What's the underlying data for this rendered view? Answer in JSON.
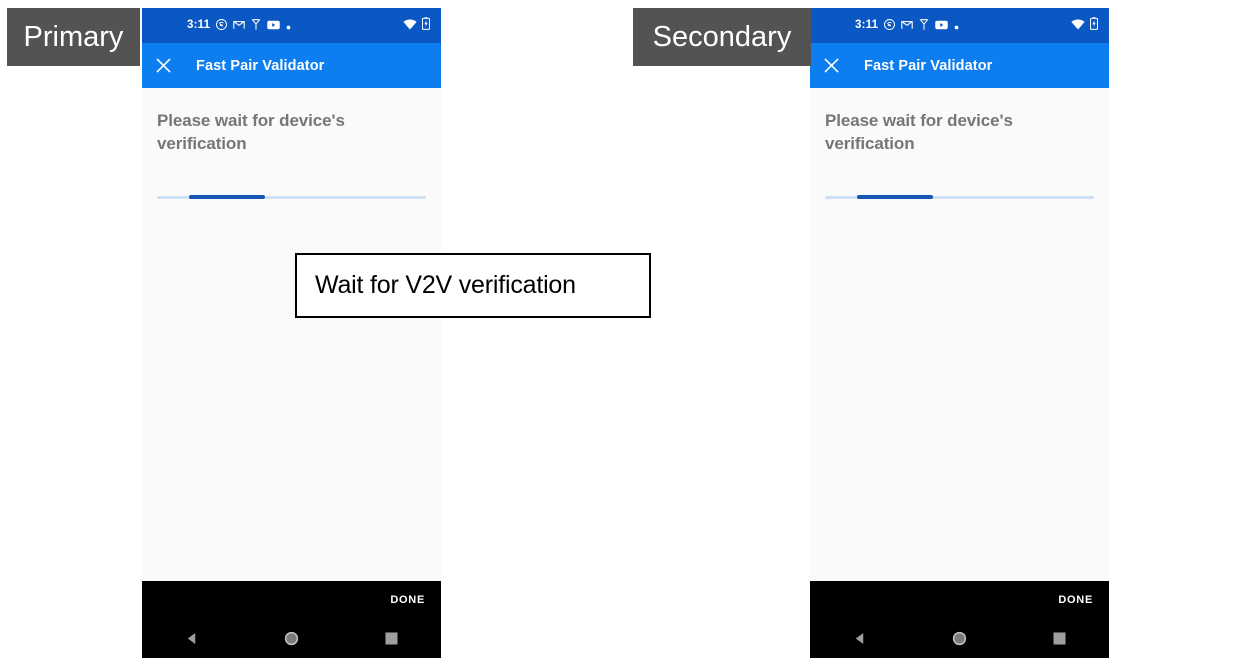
{
  "badges": {
    "primary": "Primary",
    "secondary": "Secondary"
  },
  "caption": {
    "text": "Wait for V2V verification"
  },
  "colors": {
    "status_bar": "#0b57c4",
    "app_bar": "#0d7ef0",
    "badge_bg": "#535353",
    "progress_fill": "#1457b5",
    "progress_track": "#cfe0f5",
    "body_text": "#767676",
    "nav_bar": "#000000",
    "screen_bg": "#fafafa"
  },
  "phones": [
    {
      "role": "primary",
      "status_bar": {
        "clock": "3:11",
        "icons": [
          "skype-icon",
          "gmail-icon",
          "hangouts-icon",
          "youtube-icon",
          "more-notifications-dot-icon"
        ],
        "right_icons": [
          "wifi-icon",
          "battery-icon"
        ]
      },
      "app_bar": {
        "close_icon": "close-icon",
        "title": "Fast Pair Validator"
      },
      "content": {
        "message": "Please wait for device's verification",
        "progress": {
          "indeterminate": true,
          "segment_start_pct": 12,
          "segment_end_pct": 40
        }
      },
      "bottom": {
        "done_label": "DONE",
        "nav_buttons": [
          "back-icon",
          "home-icon",
          "recents-icon"
        ]
      }
    },
    {
      "role": "secondary",
      "status_bar": {
        "clock": "3:11",
        "icons": [
          "skype-icon",
          "gmail-icon",
          "hangouts-icon",
          "youtube-icon",
          "more-notifications-dot-icon"
        ],
        "right_icons": [
          "wifi-icon",
          "battery-icon"
        ]
      },
      "app_bar": {
        "close_icon": "close-icon",
        "title": "Fast Pair Validator"
      },
      "content": {
        "message": "Please wait for device's verification",
        "progress": {
          "indeterminate": true,
          "segment_start_pct": 12,
          "segment_end_pct": 40
        }
      },
      "bottom": {
        "done_label": "DONE",
        "nav_buttons": [
          "back-icon",
          "home-icon",
          "recents-icon"
        ]
      }
    }
  ]
}
